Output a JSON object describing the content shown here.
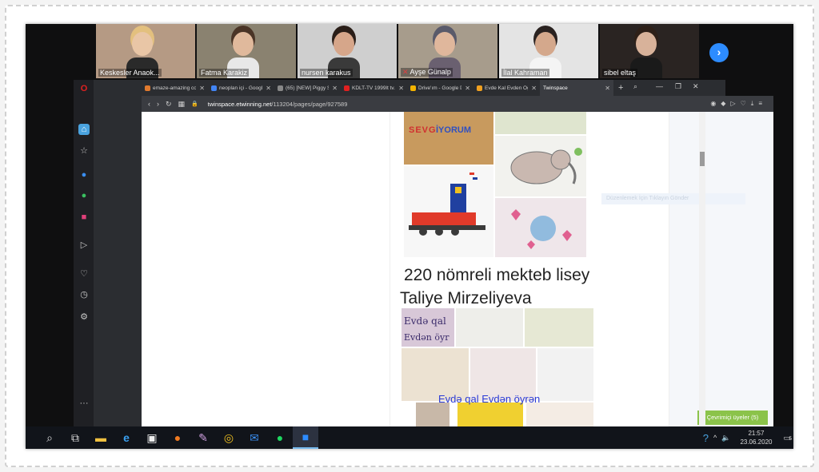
{
  "participants": [
    {
      "name": "Keskesler Anaok...",
      "muted": false,
      "bg": "#b59a84",
      "skin": "#e9c6a6",
      "hair": "#e3c07e",
      "shirt": "#2a2a2a"
    },
    {
      "name": "Fatma Karakiz",
      "muted": false,
      "bg": "#8a8270",
      "skin": "#e0b99c",
      "hair": "#4a3426",
      "shirt": "#e8e8e8",
      "active": true
    },
    {
      "name": "nursen karakus",
      "muted": false,
      "bg": "#cfcfcf",
      "skin": "#d6a68a",
      "hair": "#2a1e18",
      "shirt": "#3a3a3a"
    },
    {
      "name": "Ayşe Günalp",
      "muted": true,
      "bg": "#a79c8c",
      "skin": "#e0b79c",
      "hair": "#5a5a6a",
      "shirt": "#6a6070"
    },
    {
      "name": "İlal Kahraman",
      "muted": false,
      "bg": "#e4e4e4",
      "skin": "#d4a88c",
      "hair": "#2a2220",
      "shirt": "#f4f4f4"
    },
    {
      "name": "sibel eltaş",
      "muted": false,
      "bg": "#2a2422",
      "skin": "#d8b29a",
      "hair": "#2e2018",
      "shirt": "#1a1a1a"
    }
  ],
  "tabs": [
    {
      "label": "emaze-amazing co...",
      "color": "#e07a2e"
    },
    {
      "label": "neoplan içi - Googl...",
      "color": "#4285f4"
    },
    {
      "label": "(65) [NEW] Piggy S...",
      "color": "#888"
    },
    {
      "label": "KDLT-TV 1999lt tv...",
      "color": "#e02020"
    },
    {
      "label": "Drive'ım - Google D...",
      "color": "#f4b400"
    },
    {
      "label": "Evde Kal Evden Öğr...",
      "color": "#f0a020"
    },
    {
      "label": "Twinspace",
      "color": "#2b2d31",
      "active": true
    }
  ],
  "url": {
    "host": "twinspace.etwinning.net",
    "path": "/113204/pages/page/927589"
  },
  "ghost_text": "Düzenlemek İçin Tıklayın Gönder",
  "heading": {
    "line1": "220 nömreli mekteb lisey",
    "line2": "Taliye Mirzeliyeva"
  },
  "collage_caption": "Evdə qal Evdən öyrən",
  "online_badge": "Çevrimiçi üyeler (5)",
  "clock": {
    "time": "21:57",
    "date": "23.06.2020"
  },
  "notif_count": "5"
}
